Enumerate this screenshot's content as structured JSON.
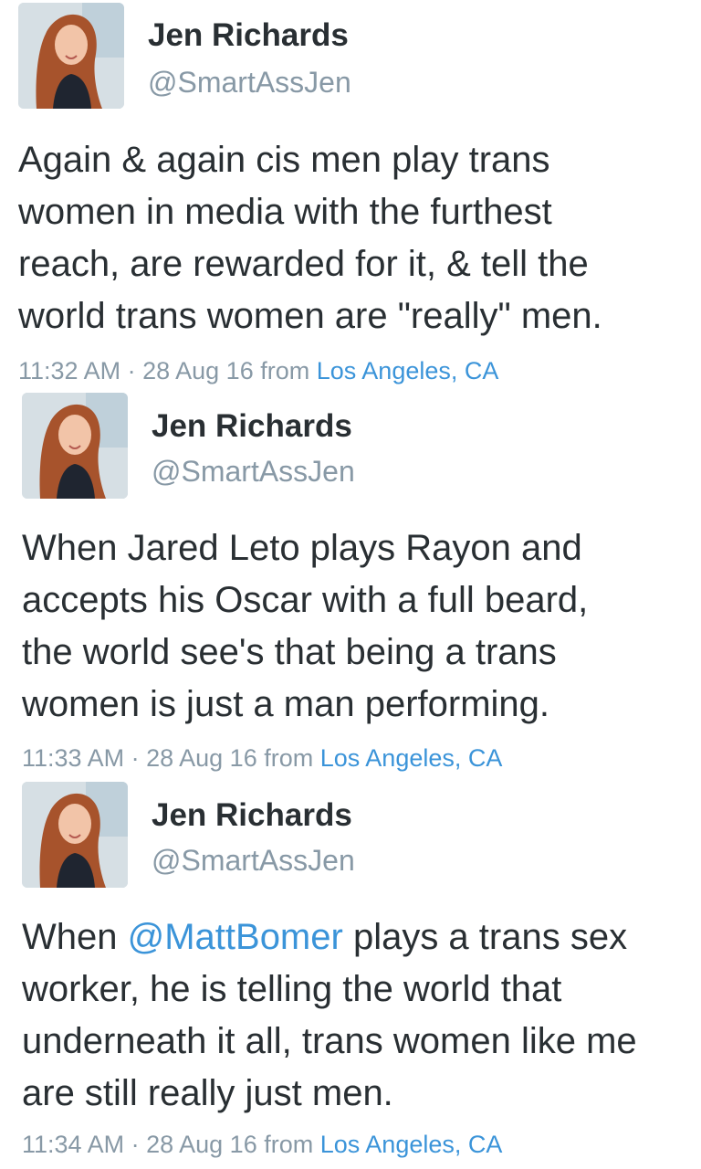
{
  "tweets": [
    {
      "name": "Jen Richards",
      "handle": "@SmartAssJen",
      "lines": [
        "Again & again cis men play trans",
        "women in media with the furthest",
        "reach, are rewarded for it, & tell the",
        "world trans women are \"really\" men."
      ],
      "time": "11:32 AM",
      "date": "· 28 Aug 16",
      "from": "from",
      "location": "Los Angeles, CA"
    },
    {
      "name": "Jen Richards",
      "handle": "@SmartAssJen",
      "lines": [
        "When Jared Leto plays Rayon and",
        "accepts his Oscar with a full beard,",
        "the world see's that being a trans",
        "women is just a man performing."
      ],
      "time": "11:33 AM",
      "date": "· 28 Aug 16",
      "from": "from",
      "location": "Los Angeles, CA"
    },
    {
      "name": "Jen Richards",
      "handle": "@SmartAssJen",
      "line1_prefix": "When ",
      "mention": "@MattBomer",
      "line1_suffix": " plays a trans sex",
      "lines": [
        "worker, he is telling the world that",
        "underneath it all, trans women like me",
        "are still really just men."
      ],
      "time": "11:34 AM",
      "date": "· 28 Aug 16",
      "from": "from",
      "location": "Los Angeles, CA"
    }
  ],
  "colors": {
    "text": "#292f33",
    "secondary": "#8899a6",
    "link": "#3b94d9"
  },
  "icons": {
    "avatar": "profile-photo"
  }
}
